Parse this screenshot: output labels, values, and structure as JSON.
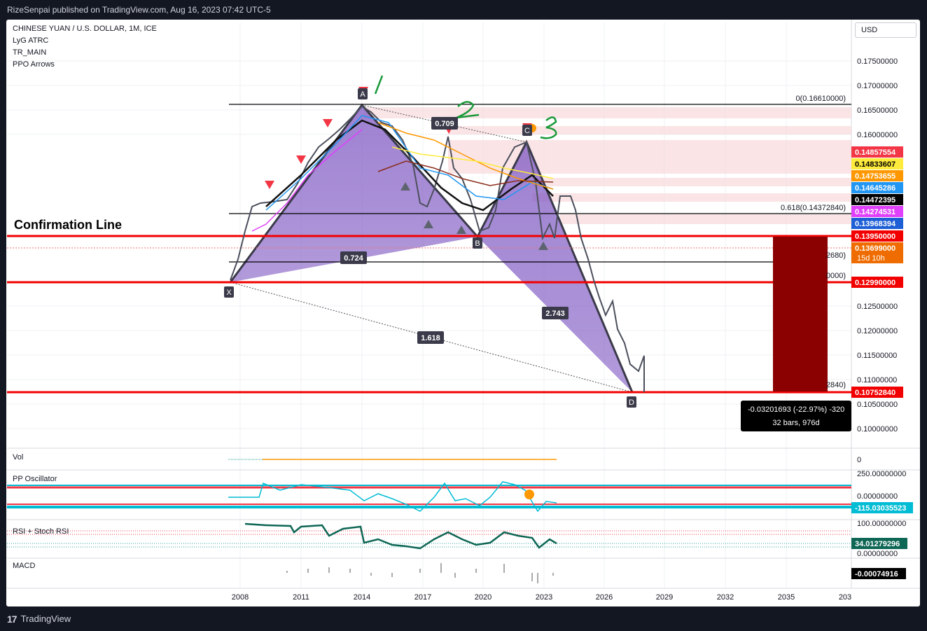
{
  "header": {
    "publisher_line": "RizeSenpai published on TradingView.com, Aug 16, 2023 07:42 UTC-5"
  },
  "footer": {
    "brand": "TradingView"
  },
  "legend": {
    "symbol": "CHINESE YUAN / U.S. DOLLAR, 1M, ICE",
    "indicators": [
      "LyG ATRC",
      "TR_MAIN",
      "PPO Arrows"
    ]
  },
  "currency_button": "USD",
  "annotations": {
    "confirmation_line": "Confirmation Line",
    "handwritten": [
      "1",
      "2",
      "3"
    ],
    "points": [
      "X",
      "A",
      "B",
      "C",
      "D"
    ],
    "ratios": [
      "0.709",
      "0.724",
      "2.743",
      "1.618"
    ],
    "fib_top": "0(0.16610000)",
    "fib_618": "0.618(0.14372840)",
    "fib_partial_1": "2680)",
    "fib_partial_2": "0000)",
    "fib_partial_3": "2840)",
    "measure_line1": "-0.03201693 (-22.97%) -320",
    "measure_line2": "32 bars, 976d"
  },
  "price_axis": {
    "ticks": [
      "0.17500000",
      "0.17000000",
      "0.16500000",
      "0.16000000",
      "0.12500000",
      "0.12000000",
      "0.11500000",
      "0.11000000",
      "0.10500000",
      "0.10000000"
    ],
    "tags": [
      {
        "text": "0.14857554",
        "color": "#f23645"
      },
      {
        "text": "0.14833607",
        "color": "#ffeb3b"
      },
      {
        "text": "0.14753655",
        "color": "#ff9800"
      },
      {
        "text": "0.14645286",
        "color": "#2196f3"
      },
      {
        "text": "0.14472395",
        "color": "#000000"
      },
      {
        "text": "0.14274531",
        "color": "#e040fb"
      },
      {
        "text": "0.13968394",
        "color": "#1e5fd6"
      },
      {
        "text": "0.13950000",
        "color": "#f20000"
      },
      {
        "text": "0.13699000",
        "color": "#ef6c00"
      },
      {
        "text": "0.12990000",
        "color": "#f20000"
      },
      {
        "text": "0.10752840",
        "color": "#f20000"
      }
    ],
    "countdown": "15d 10h"
  },
  "time_axis": {
    "labels": [
      "2008",
      "2011",
      "2014",
      "2017",
      "2020",
      "2023",
      "2026",
      "2029",
      "2032",
      "2035",
      "203"
    ]
  },
  "panes": {
    "vol": {
      "label": "Vol",
      "axis_value": "0"
    },
    "pp_osc": {
      "label": "PP Oscillator",
      "ticks": [
        "250.00000000",
        "0.00000000"
      ],
      "tag": "-115.03035523",
      "tag_color": "#00bcd4"
    },
    "rsi": {
      "label": "RSI + Stoch RSI",
      "ticks": [
        "100.00000000",
        "0.00000000"
      ],
      "tag": "34.01279296",
      "tag_color": "#0e6655"
    },
    "macd": {
      "label": "MACD",
      "tag": "-0.00074916",
      "tag_color": "#000000"
    }
  }
}
